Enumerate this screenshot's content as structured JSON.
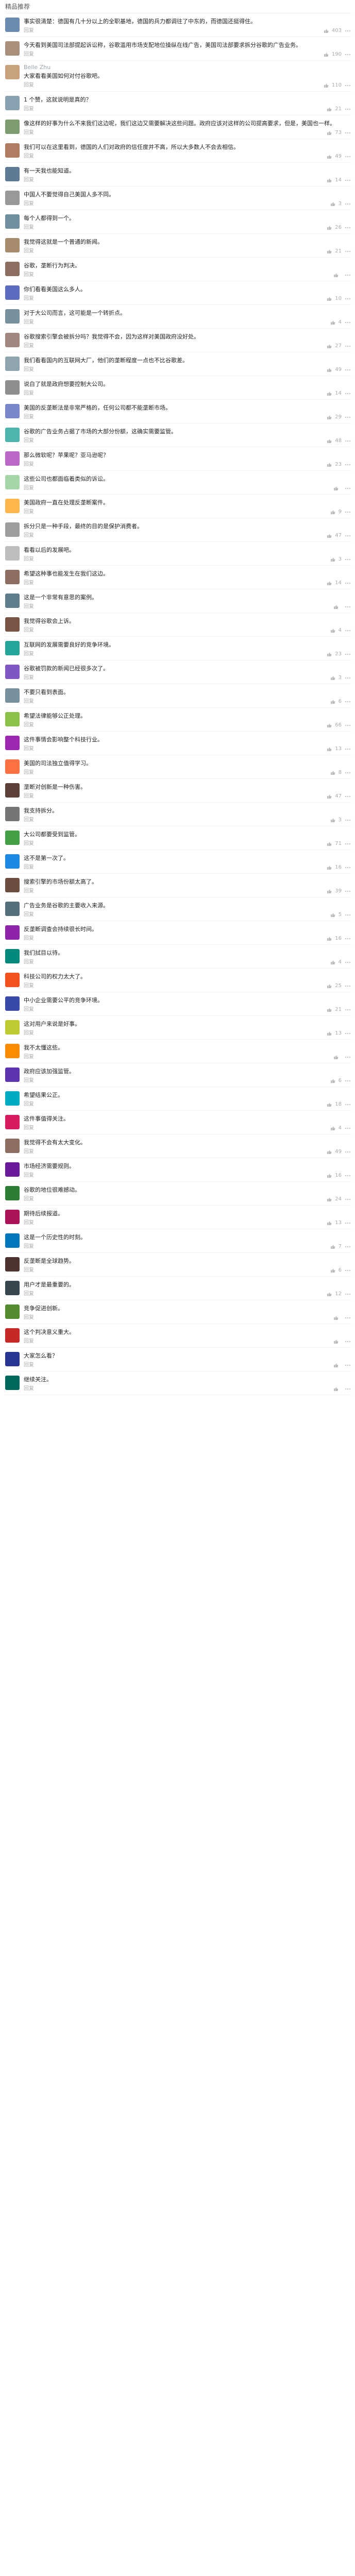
{
  "section_title": "精品推荐",
  "reply_label": "回复",
  "comments": [
    {
      "user": "",
      "text": "事实很清楚：德国有几十分以上的全职基地，德国的兵力都调往了中东的，而德国还挺得住。",
      "time": "2023-01-29",
      "likes": "403",
      "color": "#6b8cae"
    },
    {
      "user": "",
      "text": "今天看到美国司法部提起诉讼称，谷歌滥用市场支配地位操纵在线广告，美国司法部要求拆分谷歌的广告业务。",
      "time": "",
      "likes": "190",
      "color": "#a9907a"
    },
    {
      "user": "Belle Zhu",
      "text": "大家看看美国如何对付谷歌吧。",
      "time": "",
      "likes": "110",
      "color": "#c8a27c"
    },
    {
      "user": "",
      "text": "1 个赞，这就说明是真的？",
      "time": "",
      "likes": "21",
      "color": "#8aa1b1"
    },
    {
      "user": "",
      "text": "像这样的好事为什么不来我们这边呢，我们这边又需要解决这些问题。政府应该对这样的公司提高要求，但是，美国也一样。",
      "time": "",
      "likes": "73",
      "color": "#7e9c6f"
    },
    {
      "user": "",
      "text": "我们可以在这里看到，德国的人们对政府的信任度并不高，所以大多数人不会去相信。",
      "time": "",
      "likes": "49",
      "color": "#b07d62"
    },
    {
      "user": "",
      "text": "有一天我也能知道。",
      "time": "",
      "likes": "14",
      "color": "#5f7a95"
    },
    {
      "user": "",
      "text": "中国人不要觉得自己美国人多不同。",
      "time": "",
      "likes": "3",
      "color": "#999"
    },
    {
      "user": "",
      "text": "每个人都得到一个。",
      "time": "",
      "likes": "26",
      "color": "#6f8f9f"
    },
    {
      "user": "",
      "text": "我觉得这就是一个普通的新闻。",
      "time": "",
      "likes": "21",
      "color": "#a68b6d"
    },
    {
      "user": "",
      "text": "谷歌，垄断行为判决。",
      "time": "",
      "likes": "",
      "color": "#8d6e63"
    },
    {
      "user": "",
      "text": "你们看看美国这么多人。",
      "time": "",
      "likes": "10",
      "color": "#5c6bc0"
    },
    {
      "user": "",
      "text": "对于大公司而言，这可能是一个转折点。",
      "time": "",
      "likes": "4",
      "color": "#78909c"
    },
    {
      "user": "",
      "text": "谷歌搜索引擎会被拆分吗？我觉得不会，因为这样对美国政府没好处。",
      "time": "",
      "likes": "27",
      "color": "#a1887f"
    },
    {
      "user": "",
      "text": "我们看看国内的互联网大厂，他们的垄断程度一点也不比谷歌差。",
      "time": "",
      "likes": "49",
      "color": "#90a4ae"
    },
    {
      "user": "",
      "text": "说白了就是政府想要控制大公司。",
      "time": "",
      "likes": "14",
      "color": "#8e8e8e"
    },
    {
      "user": "",
      "text": "美国的反垄断法是非常严格的，任何公司都不能垄断市场。",
      "time": "",
      "likes": "29",
      "color": "#7986cb"
    },
    {
      "user": "",
      "text": "谷歌的广告业务占据了市场的大部分份额，这确实需要监管。",
      "time": "",
      "likes": "48",
      "color": "#4db6ac"
    },
    {
      "user": "",
      "text": "那么微软呢？苹果呢？亚马逊呢？",
      "time": "",
      "likes": "23",
      "color": "#ba68c8"
    },
    {
      "user": "",
      "text": "这些公司也都面临着类似的诉讼。",
      "time": "",
      "likes": "",
      "color": "#a5d6a7"
    },
    {
      "user": "",
      "text": "美国政府一直在处理反垄断案件。",
      "time": "",
      "likes": "9",
      "color": "#ffb74d"
    },
    {
      "user": "",
      "text": "拆分只是一种手段，最终的目的是保护消费者。",
      "time": "",
      "likes": "47",
      "color": "#9e9e9e"
    },
    {
      "user": "",
      "text": "看看以后的发展吧。",
      "time": "",
      "likes": "3",
      "color": "#bdbdbd"
    },
    {
      "user": "",
      "text": "希望这种事也能发生在我们这边。",
      "time": "",
      "likes": "14",
      "color": "#8d6e63"
    },
    {
      "user": "",
      "text": "这是一个非常有意思的案例。",
      "time": "",
      "likes": "",
      "color": "#607d8b"
    },
    {
      "user": "",
      "text": "我觉得谷歌会上诉。",
      "time": "",
      "likes": "4",
      "color": "#795548"
    },
    {
      "user": "",
      "text": "互联网的发展需要良好的竞争环境。",
      "time": "",
      "likes": "23",
      "color": "#26a69a"
    },
    {
      "user": "",
      "text": "谷歌被罚款的新闻已经很多次了。",
      "time": "",
      "likes": "3",
      "color": "#7e57c2"
    },
    {
      "user": "",
      "text": "不要只看到表面。",
      "time": "",
      "likes": "6",
      "color": "#78909c"
    },
    {
      "user": "",
      "text": "希望法律能够公正处理。",
      "time": "",
      "likes": "66",
      "color": "#8bc34a"
    },
    {
      "user": "",
      "text": "这件事情会影响整个科技行业。",
      "time": "",
      "likes": "13",
      "color": "#9c27b0"
    },
    {
      "user": "",
      "text": "美国的司法独立值得学习。",
      "time": "",
      "likes": "8",
      "color": "#ff7043"
    },
    {
      "user": "",
      "text": "垄断对创新是一种伤害。",
      "time": "",
      "likes": "47",
      "color": "#5d4037"
    },
    {
      "user": "",
      "text": "我支持拆分。",
      "time": "",
      "likes": "3",
      "color": "#757575"
    },
    {
      "user": "",
      "text": "大公司都要受到监管。",
      "time": "",
      "likes": "71",
      "color": "#43a047"
    },
    {
      "user": "",
      "text": "这不是第一次了。",
      "time": "",
      "likes": "16",
      "color": "#1e88e5"
    },
    {
      "user": "",
      "text": "搜索引擎的市场份额太高了。",
      "time": "",
      "likes": "39",
      "color": "#6d4c41"
    },
    {
      "user": "",
      "text": "广告业务是谷歌的主要收入来源。",
      "time": "",
      "likes": "5",
      "color": "#546e7a"
    },
    {
      "user": "",
      "text": "反垄断调查会持续很长时间。",
      "time": "",
      "likes": "16",
      "color": "#8e24aa"
    },
    {
      "user": "",
      "text": "我们拭目以待。",
      "time": "",
      "likes": "4",
      "color": "#00897b"
    },
    {
      "user": "",
      "text": "科技公司的权力太大了。",
      "time": "",
      "likes": "25",
      "color": "#f4511e"
    },
    {
      "user": "",
      "text": "中小企业需要公平的竞争环境。",
      "time": "",
      "likes": "21",
      "color": "#3949ab"
    },
    {
      "user": "",
      "text": "这对用户来说是好事。",
      "time": "",
      "likes": "13",
      "color": "#c0ca33"
    },
    {
      "user": "",
      "text": "我不太懂这些。",
      "time": "",
      "likes": "",
      "color": "#fb8c00"
    },
    {
      "user": "",
      "text": "政府应该加强监管。",
      "time": "",
      "likes": "6",
      "color": "#5e35b1"
    },
    {
      "user": "",
      "text": "希望结果公正。",
      "time": "",
      "likes": "18",
      "color": "#00acc1"
    },
    {
      "user": "",
      "text": "这件事值得关注。",
      "time": "",
      "likes": "4",
      "color": "#d81b60"
    },
    {
      "user": "",
      "text": "我觉得不会有太大变化。",
      "time": "",
      "likes": "49",
      "color": "#8d6e63"
    },
    {
      "user": "",
      "text": "市场经济需要规则。",
      "time": "",
      "likes": "16",
      "color": "#6a1b9a"
    },
    {
      "user": "",
      "text": "谷歌的地位很难撼动。",
      "time": "",
      "likes": "24",
      "color": "#2e7d32"
    },
    {
      "user": "",
      "text": "期待后续报道。",
      "time": "",
      "likes": "13",
      "color": "#ad1457"
    },
    {
      "user": "",
      "text": "这是一个历史性的时刻。",
      "time": "",
      "likes": "7",
      "color": "#0277bd"
    },
    {
      "user": "",
      "text": "反垄断是全球趋势。",
      "time": "",
      "likes": "6",
      "color": "#4e342e"
    },
    {
      "user": "",
      "text": "用户才是最重要的。",
      "time": "",
      "likes": "12",
      "color": "#37474f"
    },
    {
      "user": "",
      "text": "竞争促进创新。",
      "time": "",
      "likes": "",
      "color": "#558b2f"
    },
    {
      "user": "",
      "text": "这个判决意义重大。",
      "time": "",
      "likes": "",
      "color": "#c62828"
    },
    {
      "user": "",
      "text": "大家怎么看？",
      "time": "",
      "likes": "",
      "color": "#283593"
    },
    {
      "user": "",
      "text": "继续关注。",
      "time": "",
      "likes": "",
      "color": "#00695c"
    }
  ]
}
